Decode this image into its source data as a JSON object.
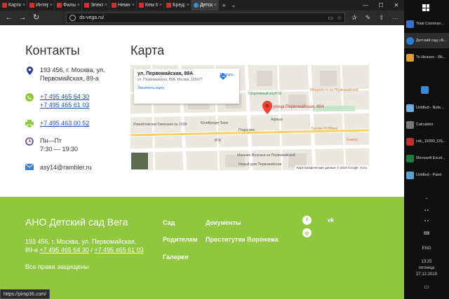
{
  "browser": {
    "tabs": [
      {
        "title": "Картинок"
      },
      {
        "title": "Интересн"
      },
      {
        "title": "Фильмы к"
      },
      {
        "title": "Электрона"
      },
      {
        "title": "Немного з"
      },
      {
        "title": "Кем был е"
      },
      {
        "title": "Бредзона"
      },
      {
        "title": "Детск",
        "active": true
      }
    ],
    "url": "ds-vega.ru/",
    "status_url": "https://pimp36.com/"
  },
  "contacts": {
    "title": "Контакты",
    "address": [
      "193 456, г. Москва, ул.",
      "Первомайская, 89-а"
    ],
    "phones": [
      "+7 495 465 64 30",
      "+7 495 465 61 03"
    ],
    "fax": "+7 495 463 00 52",
    "hours": [
      "Пн—Пт",
      "7:30 — 19:30"
    ],
    "email": "asy14@rambler.ru"
  },
  "map": {
    "title": "Карта",
    "card_title": "ул. Первомайская, 89А",
    "card_address": "ул. Первомайская, 89А, Москва, 105077",
    "card_enlarge": "Увеличить карту",
    "card_route": "Маршру...",
    "marker_label": "улица Первомайская, 89А",
    "places": {
      "sport": "Спортивный клуб 02",
      "imagazin": "IMagazin.ru на Первомайской",
      "izm_gym": "Измайловская Гимназия № 1508",
      "unicredit": "ЮниКредит Банк",
      "afisha": "Афиша",
      "podruzhka": "Подружка",
      "baskin": "Баскин Роббинс",
      "vtb": "ВТБ",
      "kampus": "Кампус",
      "igrushka": "Магазин Игрушка на Первомайской",
      "newhome": "Новый дом Первомайская"
    },
    "attribution": "Картографические данные © 2019 Google",
    "terms": "Усло"
  },
  "footer": {
    "org_name": "АНО Детский сад Вега",
    "address_line1": "193 456, г. Москва, ул. Первомайская,",
    "address_line2_prefix": "89-а ",
    "phone1": "+7 495 465 64 30",
    "sep": " / ",
    "phone2": "+7 495 465 61 03",
    "rights": "Все права защищены",
    "nav": {
      "garden": "Сад",
      "parents": "Родителям",
      "gallery": "Галереи",
      "documents": "Документы",
      "prostitutes": "Проститутки Воронежа"
    },
    "social": {
      "fb": "f",
      "vk": "vk",
      "ig": "◎"
    }
  },
  "taskbar": {
    "items": [
      {
        "title": "Total Comman...",
        "color": "#3a6fd0"
      },
      {
        "title": "Детский сад «В...",
        "color": "#2f7fd6",
        "active": true
      },
      {
        "title": "To Heaven - Wi...",
        "color": "#e0a030"
      },
      {
        "title": "",
        "color": "#3c8ad0"
      },
      {
        "title": "Untitled - Note...",
        "color": "#6ab0e8"
      },
      {
        "title": "Calculator",
        "color": "#777777"
      },
      {
        "title": "cdc_19390_DS...",
        "color": "#c23030"
      },
      {
        "title": "Microsoft Excel...",
        "color": "#1f7a40"
      },
      {
        "title": "Untitled - Paint",
        "color": "#5aa0d0"
      }
    ],
    "language": "ENG",
    "time": "13:25",
    "day": "пятница",
    "date": "27.12.2019"
  }
}
